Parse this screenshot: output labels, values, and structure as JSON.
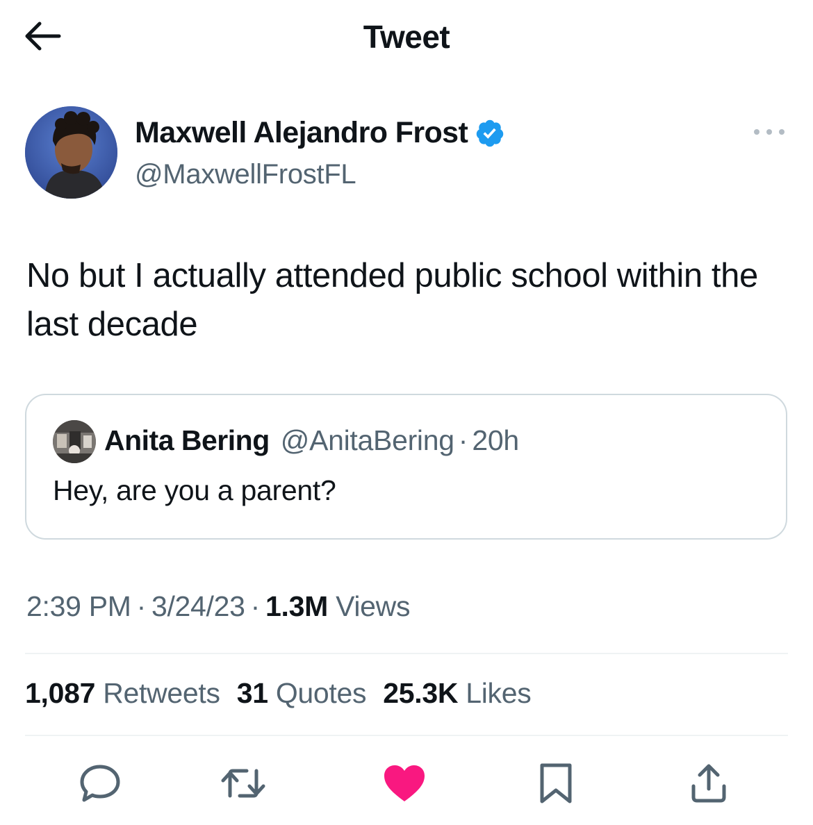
{
  "header": {
    "title": "Tweet"
  },
  "tweet": {
    "author_name": "Maxwell Alejandro Frost",
    "author_handle": "@MaxwellFrostFL",
    "text": "No but I actually attended public school within the last decade",
    "time": "2:39 PM",
    "date": "3/24/23",
    "views_count": "1.3M",
    "views_label": "Views"
  },
  "quote": {
    "author_name": "Anita Bering",
    "author_handle": "@AnitaBering",
    "time": "20h",
    "text": "Hey, are you a parent?"
  },
  "stats": {
    "retweets_count": "1,087",
    "retweets_label": "Retweets",
    "quotes_count": "31",
    "quotes_label": "Quotes",
    "likes_count": "25.3K",
    "likes_label": "Likes"
  },
  "colors": {
    "verified": "#1d9bf0",
    "like_active": "#f91880",
    "secondary_text": "#536471"
  },
  "icons": {
    "back": "arrow-left-icon",
    "more": "more-horizontal-icon",
    "verified": "verified-badge-icon",
    "reply": "reply-icon",
    "retweet": "retweet-icon",
    "like": "heart-icon",
    "bookmark": "bookmark-icon",
    "share": "share-icon"
  }
}
